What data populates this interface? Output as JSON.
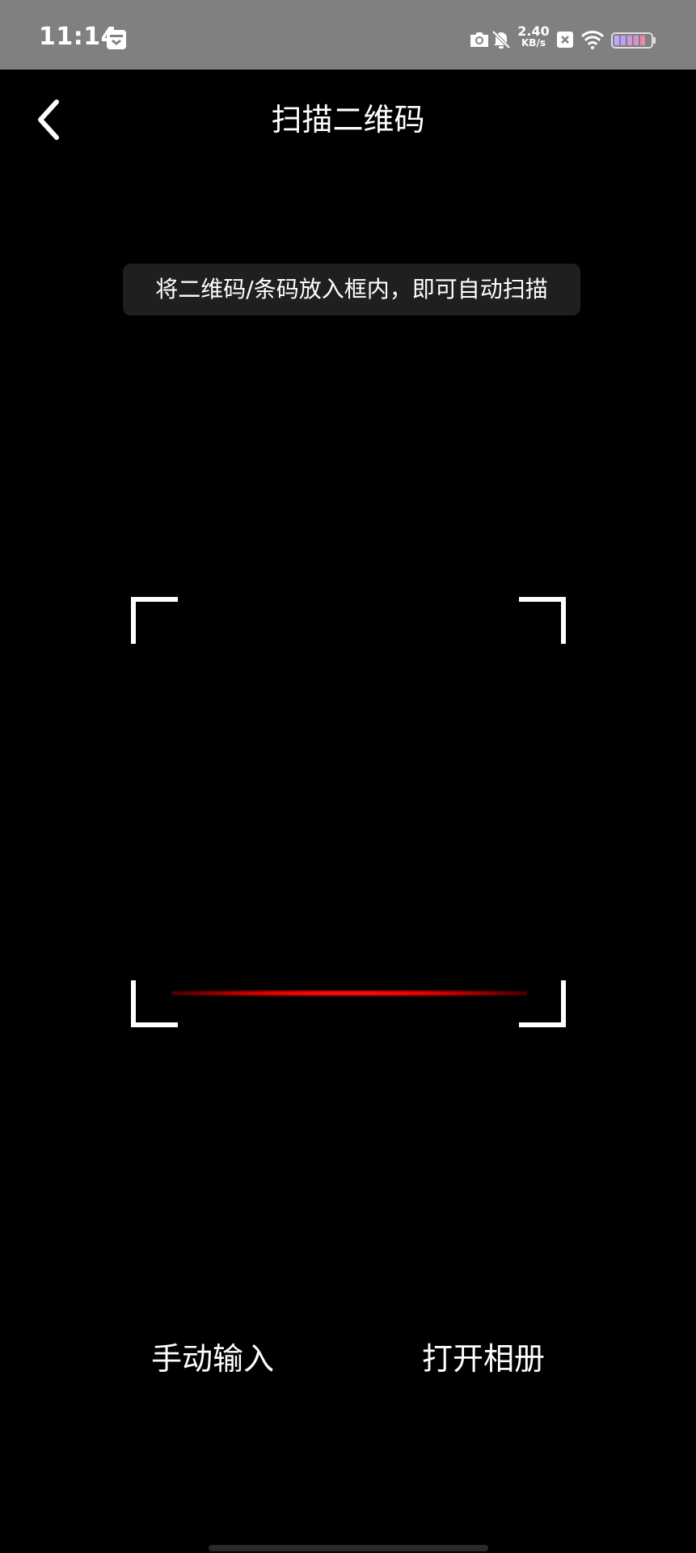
{
  "status_bar": {
    "time": "11:14",
    "net_speed_value": "2.40",
    "net_speed_unit": "KB/s",
    "icons": [
      "calendar-icon",
      "camera-icon",
      "bell-off-icon",
      "close-badge-icon",
      "wifi-icon",
      "battery-icon"
    ]
  },
  "header": {
    "title": "扫描二维码",
    "back_icon": "chevron-left-icon"
  },
  "scanner": {
    "hint": "将二维码/条码放入框内，即可自动扫描",
    "frame_color": "#ffffff",
    "scan_line_color": "#e00000"
  },
  "actions": {
    "manual_input": "手动输入",
    "open_album": "打开相册"
  }
}
